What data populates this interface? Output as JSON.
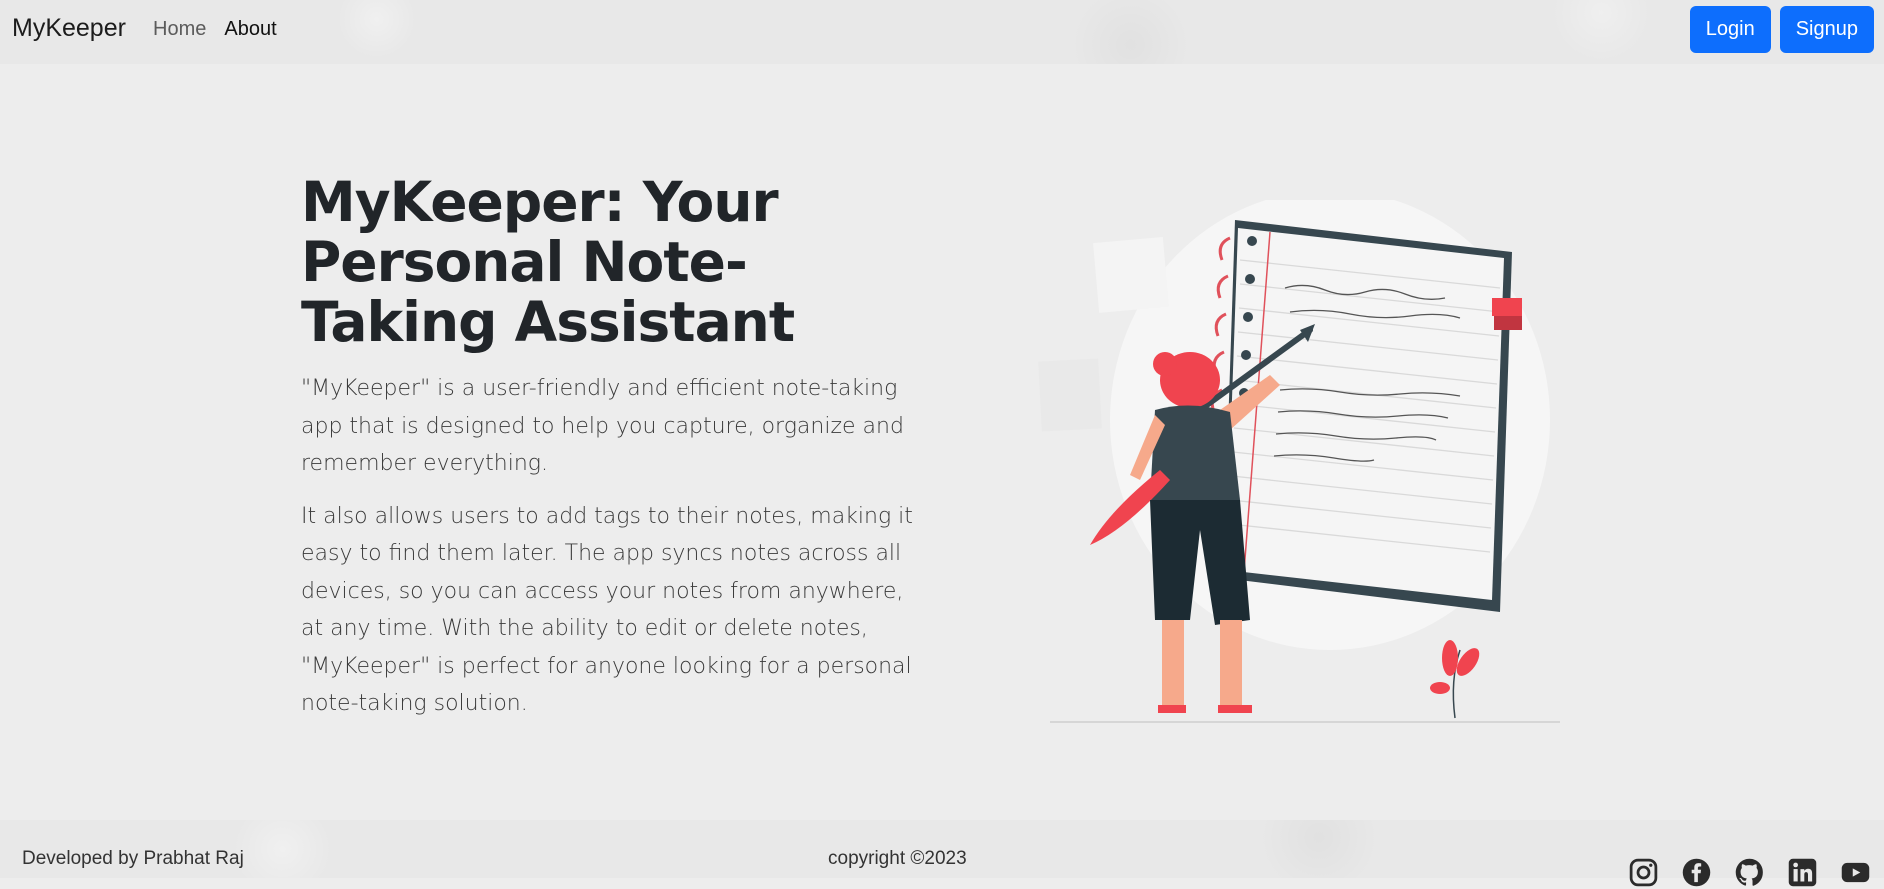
{
  "navbar": {
    "brand": "MyKeeper",
    "links": [
      {
        "label": "Home",
        "active": false
      },
      {
        "label": "About",
        "active": true
      }
    ],
    "login_label": "Login",
    "signup_label": "Signup"
  },
  "hero": {
    "title": "MyKeeper: Your Personal Note-Taking Assistant",
    "paragraph1": "\"MyKeeper\" is a user-friendly and efficient note-taking app that is designed to help you capture, organize and remember everything.",
    "paragraph2": "It also allows users to add tags to their notes, making it easy to find them later. The app syncs notes across all devices, so you can access your notes from anywhere, at any time. With the ability to edit or delete notes, \"MyKeeper\" is perfect for anyone looking for a personal note-taking solution."
  },
  "footer": {
    "developer": "Developed by Prabhat Raj",
    "copyright": "copyright ©2023",
    "social_icons": [
      "instagram-icon",
      "facebook-icon",
      "github-icon",
      "linkedin-icon",
      "youtube-icon"
    ]
  },
  "colors": {
    "primary": "#0d6efd",
    "accent_red": "#f0444f",
    "dark_teal": "#37474f"
  }
}
